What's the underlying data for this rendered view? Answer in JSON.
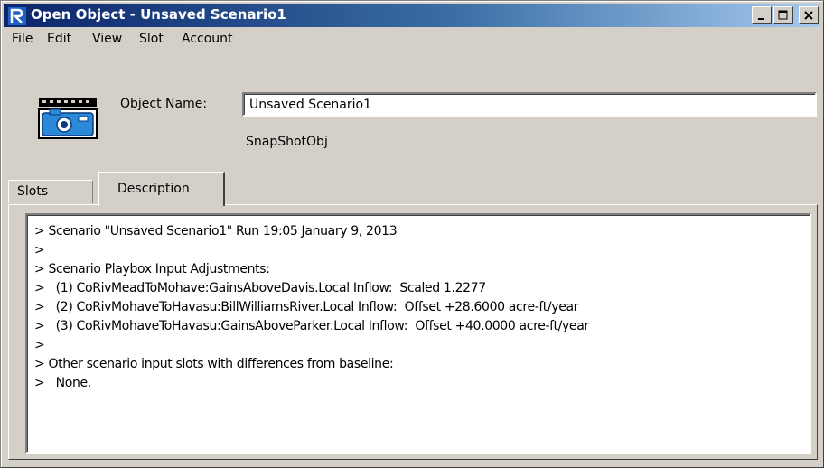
{
  "window": {
    "title": "Open Object - Unsaved Scenario1",
    "controls": {
      "minimize": "minimize",
      "maximize": "maximize",
      "close": "close"
    }
  },
  "menu": {
    "items": [
      "File",
      "Edit",
      "View",
      "Slot",
      "Account"
    ]
  },
  "object": {
    "icon": "snapshot-camera-icon",
    "name_label": "Object Name:",
    "name_value": "Unsaved Scenario1",
    "type": "SnapShotObj"
  },
  "tabs": [
    {
      "label": "Slots",
      "active": false
    },
    {
      "label": "Description",
      "active": true
    }
  ],
  "description": {
    "lines": [
      "> Scenario \"Unsaved Scenario1\" Run 19:05 January 9, 2013",
      ">",
      "> Scenario Playbox Input Adjustments:",
      ">   (1) CoRivMeadToMohave:GainsAboveDavis.Local Inflow:  Scaled 1.2277",
      ">   (2) CoRivMohaveToHavasu:BillWilliamsRiver.Local Inflow:  Offset +28.6000 acre-ft/year",
      ">   (3) CoRivMohaveToHavasu:GainsAboveParker.Local Inflow:  Offset +40.0000 acre-ft/year",
      ">",
      "> Other scenario input slots with differences from baseline:",
      ">   None."
    ]
  },
  "colors": {
    "window_face": "#d4d0c8",
    "title_gradient_start": "#0a246a",
    "title_gradient_end": "#a6caf0",
    "text_background": "#ffffff"
  }
}
